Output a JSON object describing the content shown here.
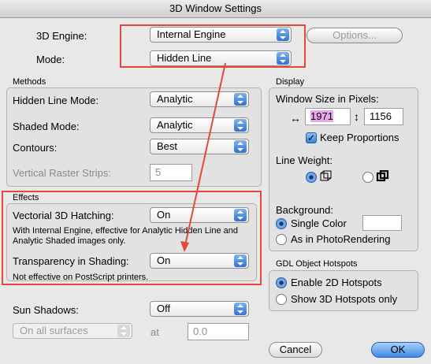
{
  "window": {
    "title": "3D Window Settings"
  },
  "engine": {
    "engine_label": "3D Engine:",
    "engine_value": "Internal Engine",
    "options_button": "Options...",
    "mode_label": "Mode:",
    "mode_value": "Hidden Line"
  },
  "methods": {
    "title": "Methods",
    "hidden_line_mode_label": "Hidden Line Mode:",
    "hidden_line_mode_value": "Analytic",
    "shaded_mode_label": "Shaded Mode:",
    "shaded_mode_value": "Analytic",
    "contours_label": "Contours:",
    "contours_value": "Best",
    "raster_label": "Vertical Raster Strips:",
    "raster_value": "5"
  },
  "effects": {
    "title": "Effects",
    "hatching_label": "Vectorial 3D Hatching:",
    "hatching_value": "On",
    "hatching_note": "With Internal Engine, effective for Analytic Hidden Line and Analytic Shaded images only.",
    "transparency_label": "Transparency in Shading:",
    "transparency_value": "On",
    "transparency_note": "Not effective on PostScript printers."
  },
  "shadows": {
    "label": "Sun Shadows:",
    "value": "Off",
    "surfaces_value": "On all surfaces",
    "at_label": "at",
    "at_value": "0.0"
  },
  "display": {
    "title": "Display",
    "window_size_label": "Window Size in Pixels:",
    "width_value": "1971",
    "height_value": "1156",
    "width_icon": "↔",
    "height_icon": "↕",
    "keep_proportions": "Keep Proportions",
    "line_weight_label": "Line Weight:",
    "background_label": "Background:",
    "single_color": "Single Color",
    "photorendering": "As in PhotoRendering"
  },
  "hotspots": {
    "title": "GDL Object Hotspots",
    "enable_2d": "Enable 2D Hotspots",
    "show_3d": "Show 3D Hotspots only"
  },
  "buttons": {
    "cancel": "Cancel",
    "ok": "OK"
  },
  "colors": {
    "annotation_red": "#e2483b",
    "accent_blue": "#3f8be4",
    "highlight_magenta": "#e6a8e8"
  }
}
